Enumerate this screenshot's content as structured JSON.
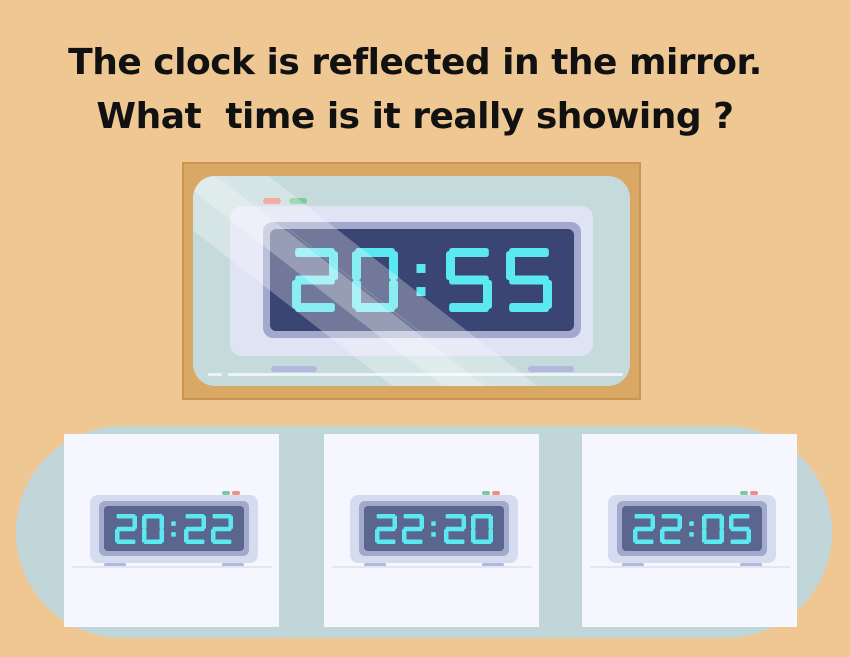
{
  "question": {
    "line1": "The clock is reflected in the mirror.",
    "line2": "What  time is it really showing ?"
  },
  "mirror_clock": {
    "display": "20:55",
    "digit_color": "#5ce8f0",
    "screen_color": "#3b4573"
  },
  "options": [
    {
      "display": "20:22"
    },
    {
      "display": "22:20"
    },
    {
      "display": "22:05"
    }
  ],
  "colors": {
    "background": "#eec793",
    "frame": "#d9a864",
    "glass": "#c5dbdb",
    "band": "#c1d6d8",
    "card": "#f5f6fe",
    "digit": "#5ce8f0",
    "button_red": "#f28d84",
    "button_green": "#7fc99a"
  }
}
